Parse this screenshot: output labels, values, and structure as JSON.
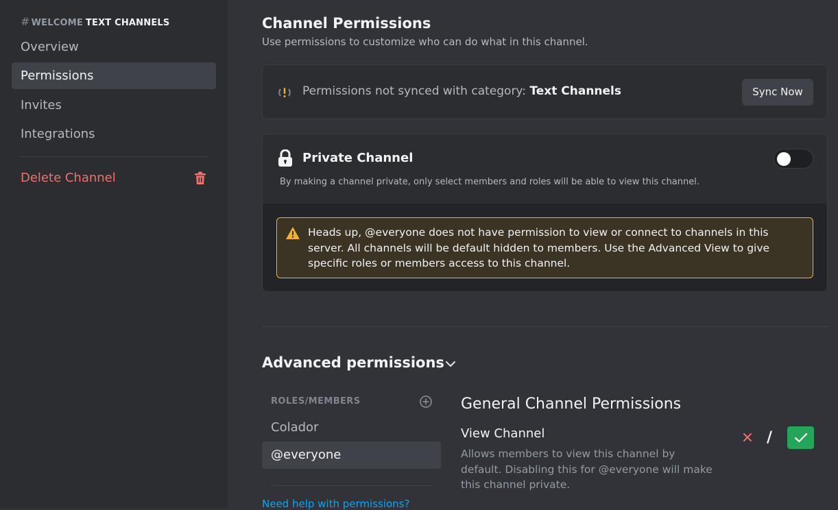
{
  "sidebar": {
    "header_channel": "WELCOME",
    "header_category": "TEXT CHANNELS",
    "items": [
      {
        "label": "Overview"
      },
      {
        "label": "Permissions"
      },
      {
        "label": "Invites"
      },
      {
        "label": "Integrations"
      }
    ],
    "delete_label": "Delete Channel",
    "selected": "Permissions"
  },
  "main": {
    "title": "Channel Permissions",
    "subtitle": "Use permissions to customize who can do what in this channel.",
    "sync": {
      "text": "Permissions not synced with category: ",
      "category": "Text Channels",
      "button": "Sync Now"
    },
    "private": {
      "title": "Private Channel",
      "description": "By making a channel private, only select members and roles will be able to view this channel.",
      "enabled": false,
      "warning": "Heads up, @everyone does not have permission to view or connect to channels in this server. All channels will be default hidden to members. Use the Advanced View to give specific roles or members access to this channel."
    },
    "advanced": {
      "title": "Advanced permissions",
      "roles_header": "ROLES/MEMBERS",
      "roles": [
        "Colador",
        "@everyone"
      ],
      "selected_role": "@everyone",
      "help_link": "Need help with permissions?",
      "section_title": "General Channel Permissions",
      "permission": {
        "name": "View Channel",
        "description": "Allows members to view this channel by default. Disabling this for @everyone will make this channel private.",
        "state": "allow",
        "neutral_glyph": "/"
      }
    }
  },
  "colors": {
    "danger": "#f0706e",
    "warning": "#f0b232",
    "allow": "#23a55a",
    "link": "#00a8fc"
  }
}
